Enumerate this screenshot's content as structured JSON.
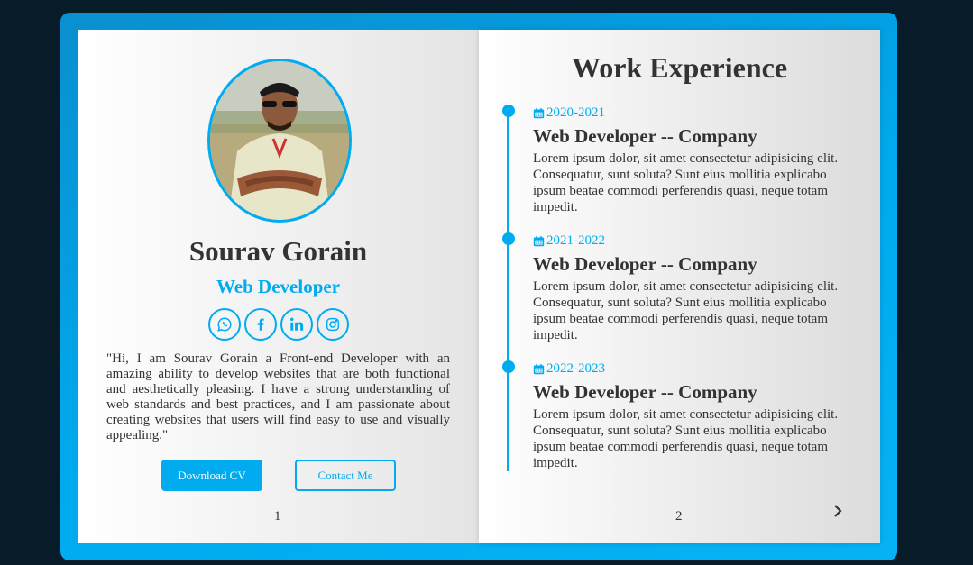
{
  "profile": {
    "name": "Sourav Gorain",
    "role": "Web Developer",
    "bio": "\"Hi, I am Sourav Gorain a Front-end Developer with an amazing ability to develop websites that are both functional and aesthetically pleasing. I have a strong understanding of web standards and best practices, and I am passionate about creating websites that users will find easy to use and visually appealing.\"",
    "socials": [
      "whatsapp-icon",
      "facebook-icon",
      "linkedin-icon",
      "instagram-icon"
    ]
  },
  "buttons": {
    "download_cv": "Download CV",
    "contact_me": "Contact Me"
  },
  "pages": {
    "left_number": "1",
    "right_number": "2"
  },
  "experience": {
    "title": "Work Experience",
    "items": [
      {
        "date": "2020-2021",
        "job": "Web Developer -- Company",
        "desc": "Lorem ipsum dolor, sit amet consectetur adipisicing elit. Consequatur, sunt soluta? Sunt eius mollitia explicabo ipsum beatae commodi perferendis quasi, neque totam impedit."
      },
      {
        "date": "2021-2022",
        "job": "Web Developer -- Company",
        "desc": "Lorem ipsum dolor, sit amet consectetur adipisicing elit. Consequatur, sunt soluta? Sunt eius mollitia explicabo ipsum beatae commodi perferendis quasi, neque totam impedit."
      },
      {
        "date": "2022-2023",
        "job": "Web Developer -- Company",
        "desc": "Lorem ipsum dolor, sit amet consectetur adipisicing elit. Consequatur, sunt soluta? Sunt eius mollitia explicabo ipsum beatae commodi perferendis quasi, neque totam impedit."
      }
    ]
  },
  "colors": {
    "accent": "#00abf0",
    "background": "#081b29",
    "text": "#333333"
  },
  "icons": {
    "date": "calendar-icon",
    "next": "chevron-right-icon"
  }
}
